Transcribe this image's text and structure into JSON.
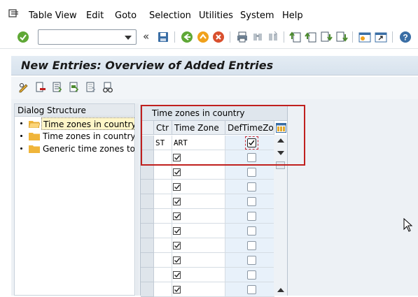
{
  "menu": {
    "items": [
      "Table View",
      "Edit",
      "Goto",
      "Selection",
      "Utilities",
      "System",
      "Help"
    ]
  },
  "toolbar": {
    "command_value": "",
    "icons": [
      "enter-icon",
      "command-dropdown-icon",
      "collapse-icon",
      "save-icon",
      "back-icon",
      "exit-icon",
      "cancel-icon",
      "print-icon",
      "find-icon",
      "find-next-icon",
      "first-page-icon",
      "previous-page-icon",
      "next-page-icon",
      "last-page-icon",
      "create-session-icon",
      "shortcut-icon",
      "help-icon"
    ]
  },
  "title": "New Entries: Overview of Added Entries",
  "app_toolbar": {
    "icons": [
      "change-display-icon",
      "delete-icon",
      "select-all-icon",
      "select-block-icon",
      "deselect-all-icon",
      "glasses-icon"
    ]
  },
  "dialog_structure": {
    "header": "Dialog Structure",
    "items": [
      {
        "label": "Time zones in country",
        "selected": true
      },
      {
        "label": "Time zones in country/re",
        "selected": false
      },
      {
        "label": "Generic time zones to po",
        "selected": false
      }
    ]
  },
  "table": {
    "title": "Time zones in country",
    "columns": [
      "Ctr",
      "Time Zone",
      "DefTimeZon"
    ],
    "rows": [
      {
        "ctr": "ST",
        "tz": "ART",
        "def": true
      },
      {
        "ctr": "",
        "tz": "",
        "def": false
      },
      {
        "ctr": "",
        "tz": "",
        "def": false
      },
      {
        "ctr": "",
        "tz": "",
        "def": false
      },
      {
        "ctr": "",
        "tz": "",
        "def": false
      },
      {
        "ctr": "",
        "tz": "",
        "def": false
      },
      {
        "ctr": "",
        "tz": "",
        "def": false
      },
      {
        "ctr": "",
        "tz": "",
        "def": false
      },
      {
        "ctr": "",
        "tz": "",
        "def": false
      },
      {
        "ctr": "",
        "tz": "",
        "def": false
      },
      {
        "ctr": "",
        "tz": "",
        "def": false
      }
    ]
  },
  "colors": {
    "highlight": "#c0201e",
    "title_bg": "#d7e2ed",
    "selected_item_bg": "#fff6c8",
    "folder": "#f0b53a"
  }
}
